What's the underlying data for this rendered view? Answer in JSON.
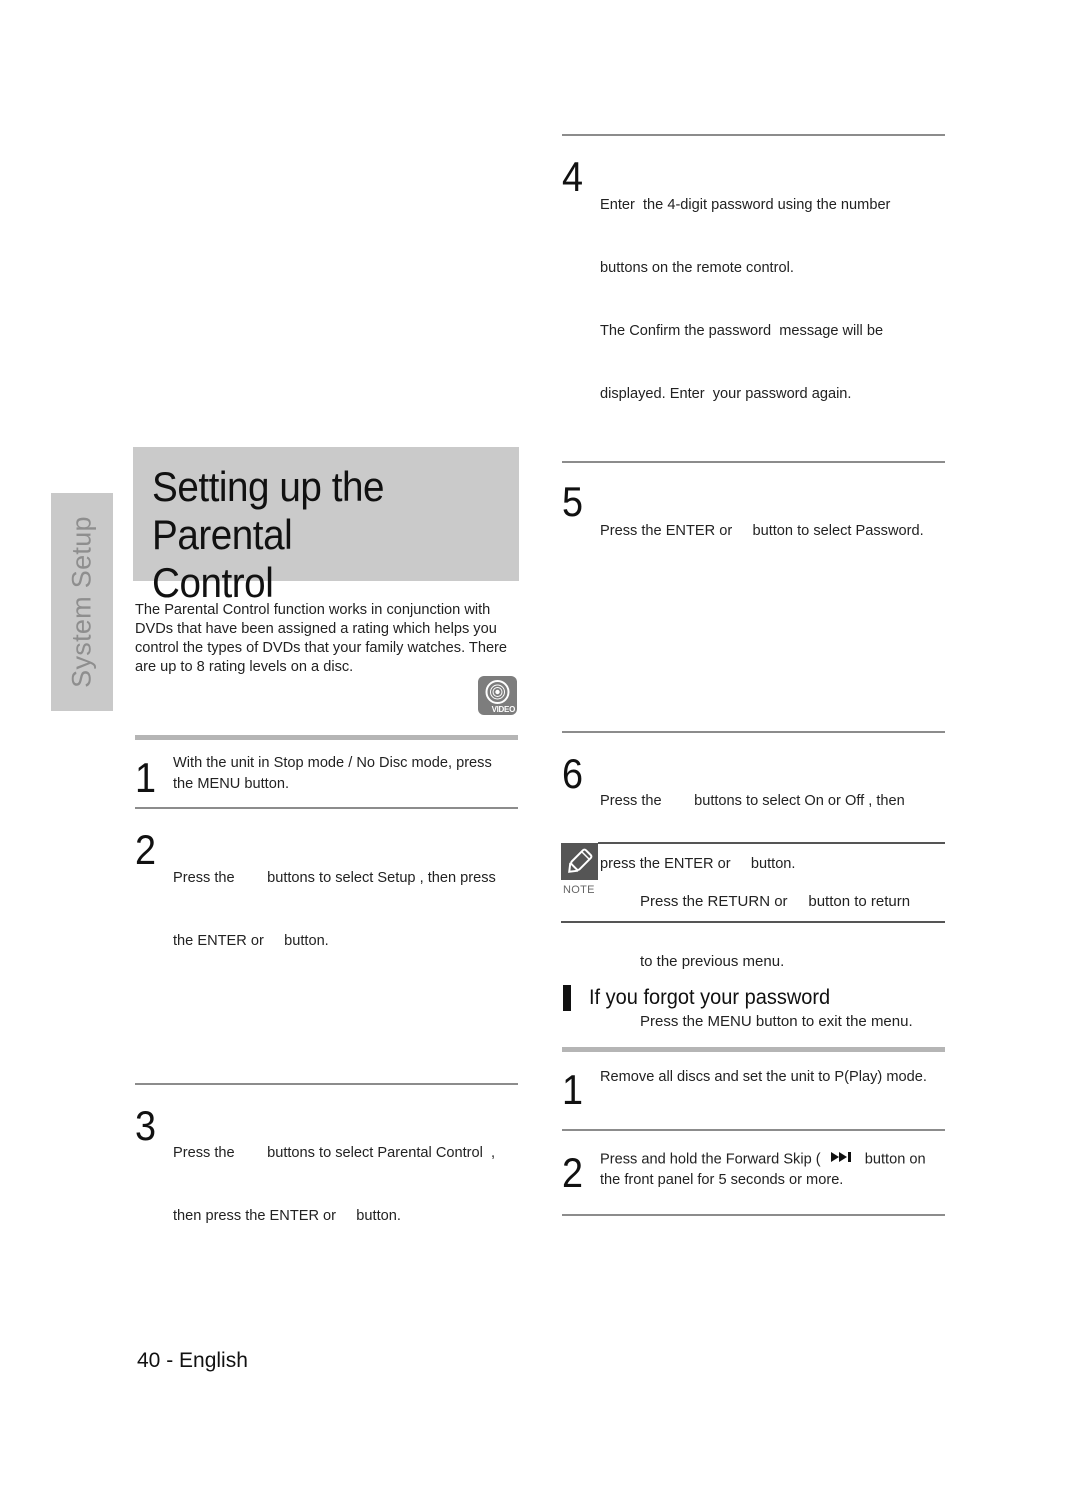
{
  "side_tab": {
    "label": "System Setup"
  },
  "title": {
    "line1": "Setting up the Parental",
    "line2": "Control"
  },
  "intro": "The Parental Control function works in conjunction with DVDs that have been assigned a rating which helps you control the types of DVDs that your family watches. There are up to 8 rating levels on a disc.",
  "badge": {
    "icon": "video-disc-icon",
    "label": "VIDEO"
  },
  "steps": [
    {
      "num": "1",
      "lines": [
        "With the unit in Stop mode / No Disc mode, press",
        "the MENU button."
      ]
    },
    {
      "num": "2",
      "lines": [
        "Press the        buttons to select Setup , then press",
        "the ENTER or     button."
      ]
    },
    {
      "num": "3",
      "lines": [
        "Press the        buttons to select Parental Control  ,",
        "then press the ENTER or     button."
      ]
    },
    {
      "num": "4",
      "lines": [
        "Enter  the 4-digit password using the number",
        "buttons on the remote control.",
        "The Confirm the password  message will be",
        "displayed. Enter  your password again."
      ]
    },
    {
      "num": "5",
      "lines": [
        "Press the ENTER or     button to select Password."
      ]
    },
    {
      "num": "6",
      "lines": [
        "Press the        buttons to select On or Off , then",
        "press the ENTER or     button."
      ]
    }
  ],
  "note": {
    "icon": "pencil-note-icon",
    "label": "NOTE",
    "lines": [
      "Press the RETURN or     button to return",
      "to the previous menu.",
      "Press the MENU button to exit the menu."
    ]
  },
  "forgot": {
    "heading": "If you forgot your password",
    "steps": [
      {
        "num": "1",
        "lines": [
          "Remove all discs and set the unit to P(Play) mode."
        ]
      },
      {
        "num": "2",
        "line1_before": "Press and hold the Forward Skip (",
        "line1_icon": "forward-skip-icon",
        "line1_after": "button on",
        "line2": "the front panel for 5 seconds or more."
      }
    ]
  },
  "footer": {
    "page": "40 - English"
  }
}
